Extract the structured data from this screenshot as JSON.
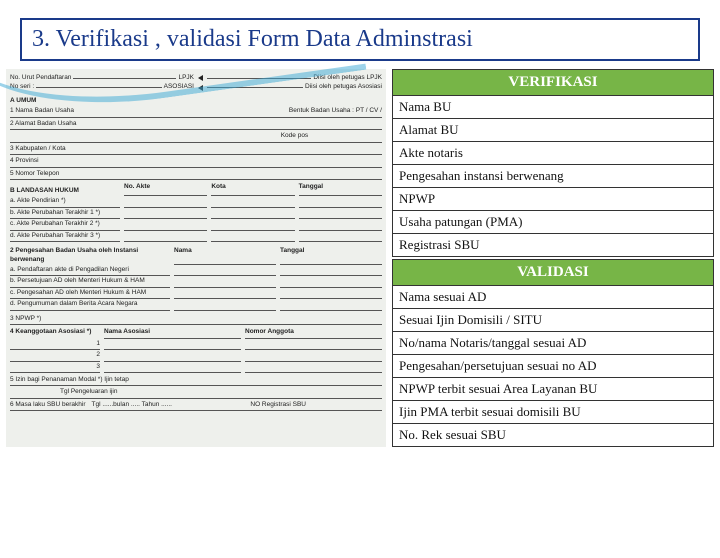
{
  "title": "3. Verifikasi , validasi Form Data Adminstrasi",
  "form": {
    "topLeft1": "No. Urut Pendaftaran",
    "topLeft1v": "LPJK",
    "topRight1": "Diisi oleh petugas LPJK",
    "topLeft2": "No seri :",
    "topLeft2v": "ASOSIASI",
    "topRight2": "Diisi oleh petugas Asosiasi",
    "s_umum": "A UMUM",
    "r1": "1   Nama Badan Usaha",
    "r1b": "Bentuk Badan Usaha : PT / CV /",
    "r2": "2   Alamat Badan Usaha",
    "r2b": "Kode pos",
    "r3": "3   Kabupaten / Kota",
    "r4": "4   Provinsi",
    "r5": "5   Nomor Telepon",
    "s_landasan": "B   LANDASAN HUKUM",
    "lh_h1": "No. Akte",
    "lh_h2": "Kota",
    "lh_h3": "Tanggal",
    "lh_a": "a. Akte Pendirian *)",
    "lh_b": "b. Akte Perubahan Terakhir 1 *)",
    "lh_c": "c. Akte Perubahan Terakhir 2 *)",
    "lh_d": "d. Akte Perubahan Terakhir 3 *)",
    "r6": "2   Pengesahan Badan Usaha oleh Instansi berwenang",
    "r6h1": "Nama",
    "r6h2": "Tanggal",
    "r6a": "a. Pendaftaran akte di Pengadilan Negeri",
    "r6b": "b. Persetujuan AD oleh Menteri Hukum & HAM",
    "r6c": "c. Pengesahan AD oleh Menteri Hukum & HAM",
    "r6d": "d. Pengumuman dalam Berita Acara Negara",
    "r7": "3   NPWP *)",
    "r8": "4   Keanggotaan Asosiasi *)",
    "r8h1": "Nama Asosiasi",
    "r8h2": "Nomor Anggota",
    "r9": "5   Izin bagi Penanaman Modal *) Ijin tetap",
    "r9a": "Tgl Pengeluaran ijin",
    "r10": "6   Masa laku SBU berakhir",
    "r10a": "Tgl ......bulan ..... Tahun ......",
    "r10b": "NO Registrasi SBU"
  },
  "verifikasi": {
    "header": "VERIFIKASI",
    "items": [
      "Nama BU",
      "Alamat BU",
      "Akte notaris",
      "Pengesahan instansi berwenang",
      "NPWP",
      "Usaha patungan (PMA)",
      "Registrasi SBU"
    ]
  },
  "validasi": {
    "header": "VALIDASI",
    "items": [
      "Nama  sesuai AD",
      "Sesuai Ijin Domisili / SITU",
      "No/nama Notaris/tanggal  sesuai AD",
      "Pengesahan/persetujuan sesuai no AD",
      "NPWP terbit sesuai Area Layanan BU",
      "Ijin PMA terbit sesuai domisili BU",
      "No. Rek sesuai SBU"
    ]
  }
}
